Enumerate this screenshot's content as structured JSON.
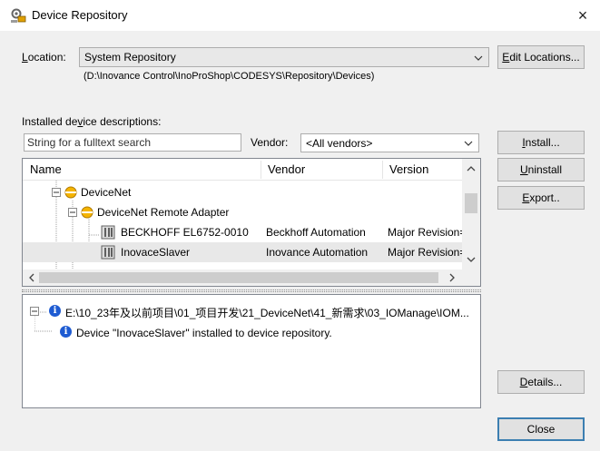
{
  "window": {
    "title": "Device Repository",
    "close_glyph": "×"
  },
  "location": {
    "label_prefix": "",
    "label_u": "L",
    "label_rest": "ocation:",
    "value": "System Repository",
    "path": "(D:\\Inovance Control\\InoProShop\\CODESYS\\Repository\\Devices)",
    "edit_prefix": "",
    "edit_u": "E",
    "edit_rest": "dit Locations..."
  },
  "installed": {
    "label_prefix": "Installed de",
    "label_u": "v",
    "label_rest": "ice descriptions:"
  },
  "search": {
    "placeholder": "String for a fulltext search"
  },
  "vendor": {
    "label": "Vendor:",
    "value": "<All vendors>"
  },
  "tree": {
    "columns": [
      "Name",
      "Vendor",
      "Version"
    ],
    "rows": [
      {
        "name": "DeviceNet",
        "vendor": "",
        "version": ""
      },
      {
        "name": "DeviceNet Remote Adapter",
        "vendor": "",
        "version": ""
      },
      {
        "name": "BECKHOFF EL6752-0010",
        "vendor": "Beckhoff Automation",
        "version": "Major Revision="
      },
      {
        "name": "InovaceSlaver",
        "vendor": "Inovance Automation",
        "version": "Major Revision="
      }
    ]
  },
  "buttons": {
    "install": {
      "u": "I",
      "rest": "nstall..."
    },
    "uninstall": {
      "u": "U",
      "rest": "ninstall"
    },
    "export": {
      "prefix": "",
      "u": "E",
      "rest": "xport.."
    },
    "details": {
      "u": "D",
      "rest": "etails..."
    },
    "close": "Close"
  },
  "log": {
    "entry": "E:\\10_23年及以前项目\\01_项目开发\\21_DeviceNet\\41_新需求\\03_IOManage\\IOM...",
    "child": "Device \"InovaceSlaver\" installed to device repository."
  },
  "colors": {
    "accent": "#3c7fb1",
    "info": "#1e5bd2",
    "device_folder": "#f5b400"
  }
}
